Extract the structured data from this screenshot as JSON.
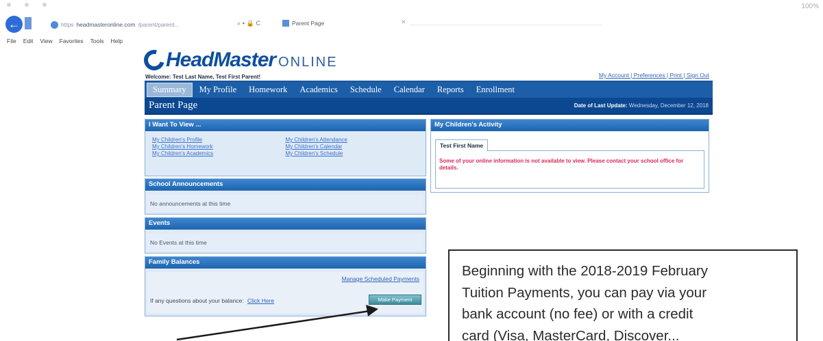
{
  "browser": {
    "top_right_text": "100%",
    "address_prefix": "https",
    "address_url": "headmasteronline.com",
    "address_rest": "/parent/parent...",
    "address_tools": "⌕ ▾ 🔒 C",
    "tab_title": "Parent Page",
    "tab_close": "✕",
    "back_glyph": "←",
    "menu": [
      "File",
      "Edit",
      "View",
      "Favorites",
      "Tools",
      "Help"
    ]
  },
  "header": {
    "brand": "HeadMaster",
    "brand_suffix": "ONLINE",
    "welcome": "Welcome: Test Last Name, Test First Parent!",
    "top_links": "My Account | Preferences | Print | Sign Out"
  },
  "nav": {
    "items": [
      "Summary",
      "My Profile",
      "Homework",
      "Academics",
      "Schedule",
      "Calendar",
      "Reports",
      "Enrollment"
    ]
  },
  "title_bar": {
    "title": "Parent Page",
    "updated_label": "Date of Last Update:",
    "updated_value": "Wednesday, December 12, 2018"
  },
  "panels": {
    "want": {
      "heading": "I Want To View ...",
      "col1": [
        "My Children's Profile",
        "My Children's Homework",
        "My Children's Academics"
      ],
      "col2": [
        "My Children's Attendance",
        "My Children's Calendar",
        "My Children's Schedule"
      ]
    },
    "announcements": {
      "heading": "School Announcements",
      "body": "No announcements at this time"
    },
    "events": {
      "heading": "Events",
      "body": "No Events at this time"
    },
    "balances": {
      "heading": "Family Balances",
      "schedule_link": "Manage Scheduled Payments",
      "question": "If any questions about your balance:",
      "question_link": "Click Here",
      "pay_button": "Make Payment"
    },
    "activity": {
      "heading": "My Children's Activity",
      "tab": "Test First Name",
      "message": "Some of your online information is not available to view. Please contact your school office for details."
    }
  },
  "notice": {
    "lines": [
      "Beginning with the 2018-2019 February",
      "Tuition Payments, you can pay via your",
      "bank account (no fee) or with a credit",
      "card (Visa, MasterCard, Discover..."
    ]
  }
}
